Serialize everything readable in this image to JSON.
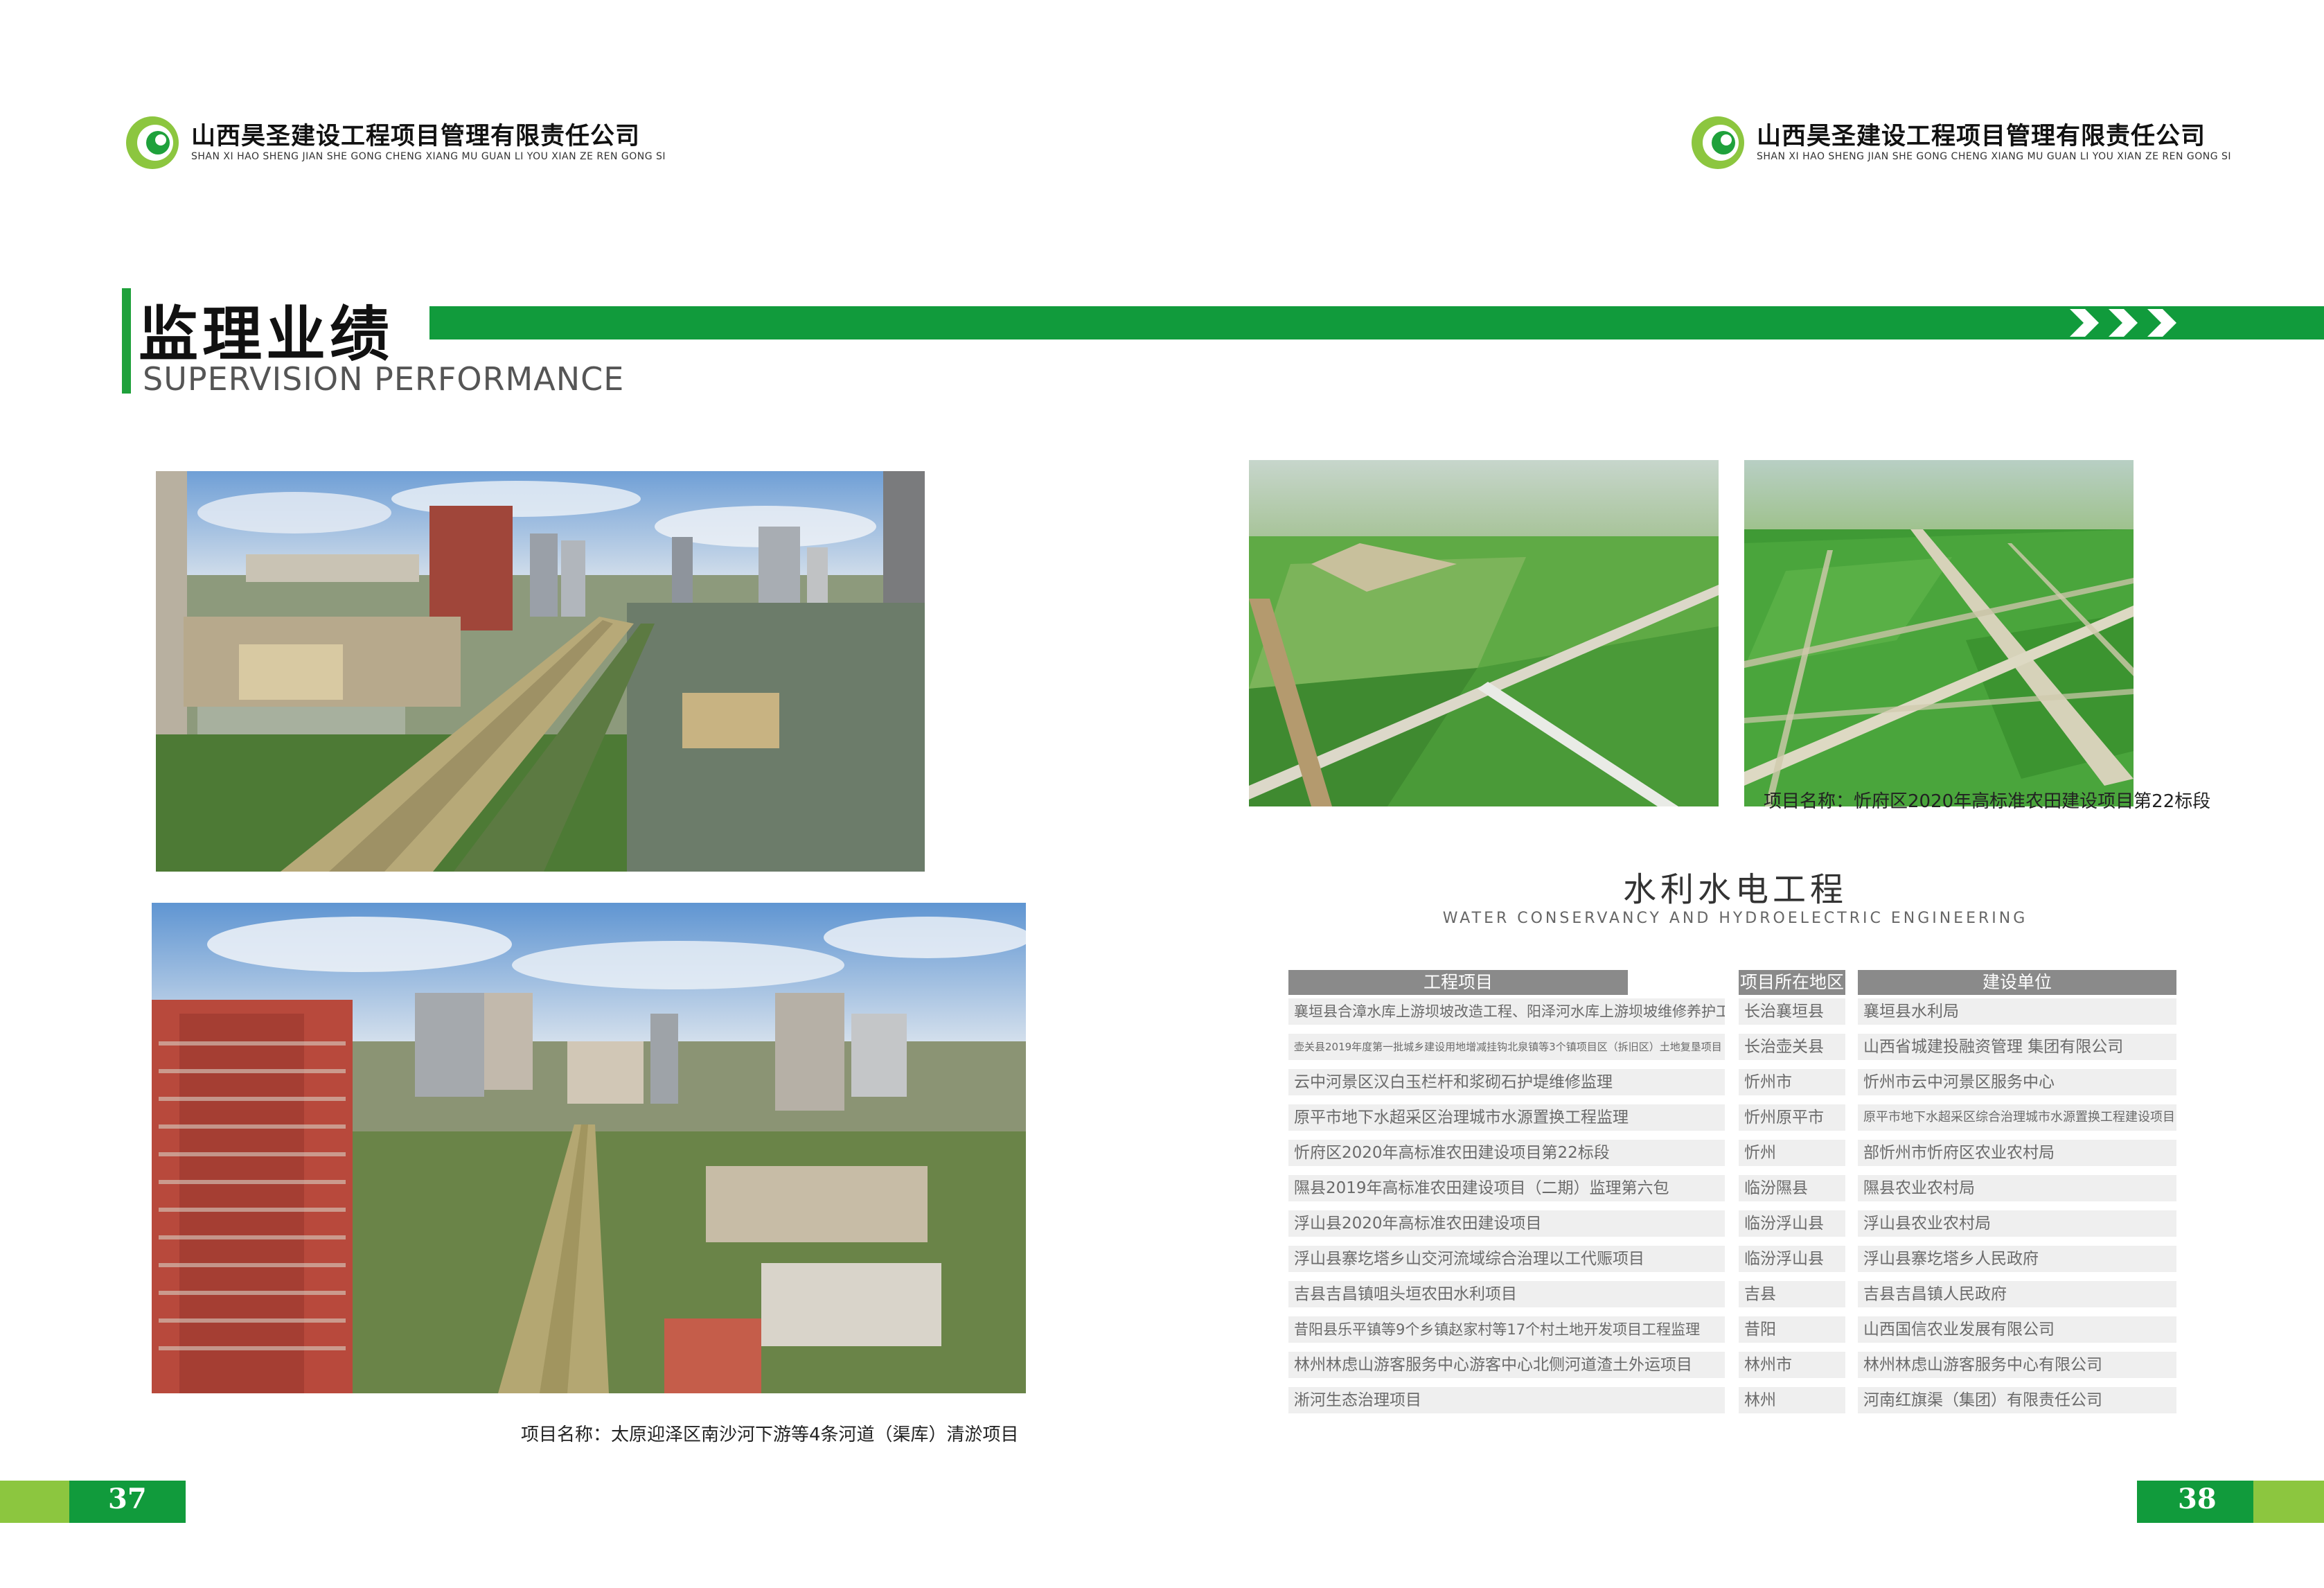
{
  "header": {
    "company_cn": "山西昊圣建设工程项目管理有限责任公司",
    "company_pinyin": "SHAN XI HAO SHENG JIAN SHE GONG CHENG XIANG MU GUAN LI YOU XIAN ZE REN GONG SI"
  },
  "title": {
    "cn": "监理业绩",
    "en": "SUPERVISION PERFORMANCE"
  },
  "left": {
    "caption": "项目名称：太原迎泽区南沙河下游等4条河道（渠库）清淤项目"
  },
  "right": {
    "caption": "项目名称：忻府区2020年高标准农田建设项目第22标段",
    "section_cn": "水利水电工程",
    "section_en": "WATER CONSERVANCY AND HYDROELECTRIC ENGINEERING"
  },
  "table": {
    "headers": [
      "工程项目",
      "项目所在地区",
      "建设单位"
    ],
    "rows": [
      [
        "襄垣县合漳水库上游坝坡改造工程、阳泽河水库上游坝坡维修养护工程",
        "长治襄垣县",
        "襄垣县水利局"
      ],
      [
        "壶关县2019年度第一批城乡建设用地增减挂钩北泉镇等3个镇项目区（拆旧区）土地复垦项目",
        "长治壶关县",
        "山西省城建投融资管理 集团有限公司"
      ],
      [
        "云中河景区汉白玉栏杆和浆砌石护堤维修监理",
        "忻州市",
        "忻州市云中河景区服务中心"
      ],
      [
        "原平市地下水超采区治理城市水源置换工程监理",
        "忻州原平市",
        "原平市地下水超采区综合治理城市水源置换工程建设项目"
      ],
      [
        "忻府区2020年高标准农田建设项目第22标段",
        "忻州",
        "部忻州市忻府区农业农村局"
      ],
      [
        "隰县2019年高标准农田建设项目（二期）监理第六包",
        "临汾隰县",
        "隰县农业农村局"
      ],
      [
        "浮山县2020年高标准农田建设项目",
        "临汾浮山县",
        "浮山县农业农村局"
      ],
      [
        "浮山县寨圪塔乡山交河流域综合治理以工代赈项目",
        "临汾浮山县",
        "浮山县寨圪塔乡人民政府"
      ],
      [
        "吉县吉昌镇咀头垣农田水利项目",
        "吉县",
        "吉县吉昌镇人民政府"
      ],
      [
        "昔阳县乐平镇等9个乡镇赵家村等17个村土地开发项目工程监理",
        "昔阳",
        "山西国信农业发展有限公司"
      ],
      [
        "林州林虑山游客服务中心游客中心北侧河道渣土外运项目",
        "林州市",
        "林州林虑山游客服务中心有限公司"
      ],
      [
        "淅河生态治理项目",
        "林州",
        "河南红旗渠（集团）有限责任公司"
      ]
    ]
  },
  "pages": {
    "left": "37",
    "right": "38"
  },
  "colors": {
    "brand_green": "#119b3c",
    "lime": "#8cc63f",
    "table_head": "#8a8a8a",
    "table_cell": "#efefef"
  },
  "icons": [
    "company-logo-icon",
    "chevron-right-icon"
  ]
}
